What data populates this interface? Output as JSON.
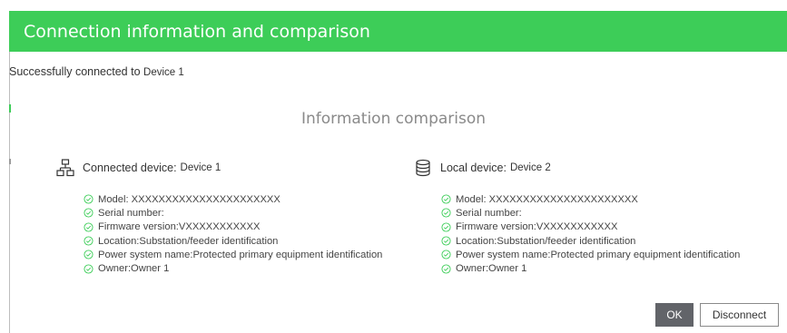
{
  "dialog": {
    "title": "Connection information and comparison",
    "status_prefix": "Successfully connected to",
    "status_device": "Device 1",
    "section_title": "Information comparison",
    "accent_color": "#3dcd58"
  },
  "connected": {
    "label": "Connected device:",
    "name": "Device 1",
    "icon": "network-icon",
    "items": [
      "Model: XXXXXXXXXXXXXXXXXXXXXX",
      "Serial number:",
      "Firmware version:VXXXXXXXXXXX",
      "Location:Substation/feeder identification",
      "Power system name:Protected primary equipment identification",
      "Owner:Owner 1"
    ]
  },
  "local": {
    "label": "Local device:",
    "name": "Device 2",
    "icon": "database-icon",
    "items": [
      "Model: XXXXXXXXXXXXXXXXXXXXXX",
      "Serial number:",
      "Firmware version:VXXXXXXXXXXX",
      "Location:Substation/feeder identification",
      "Power system name:Protected primary equipment identification",
      "Owner:Owner 1"
    ]
  },
  "buttons": {
    "ok": "OK",
    "disconnect": "Disconnect"
  }
}
